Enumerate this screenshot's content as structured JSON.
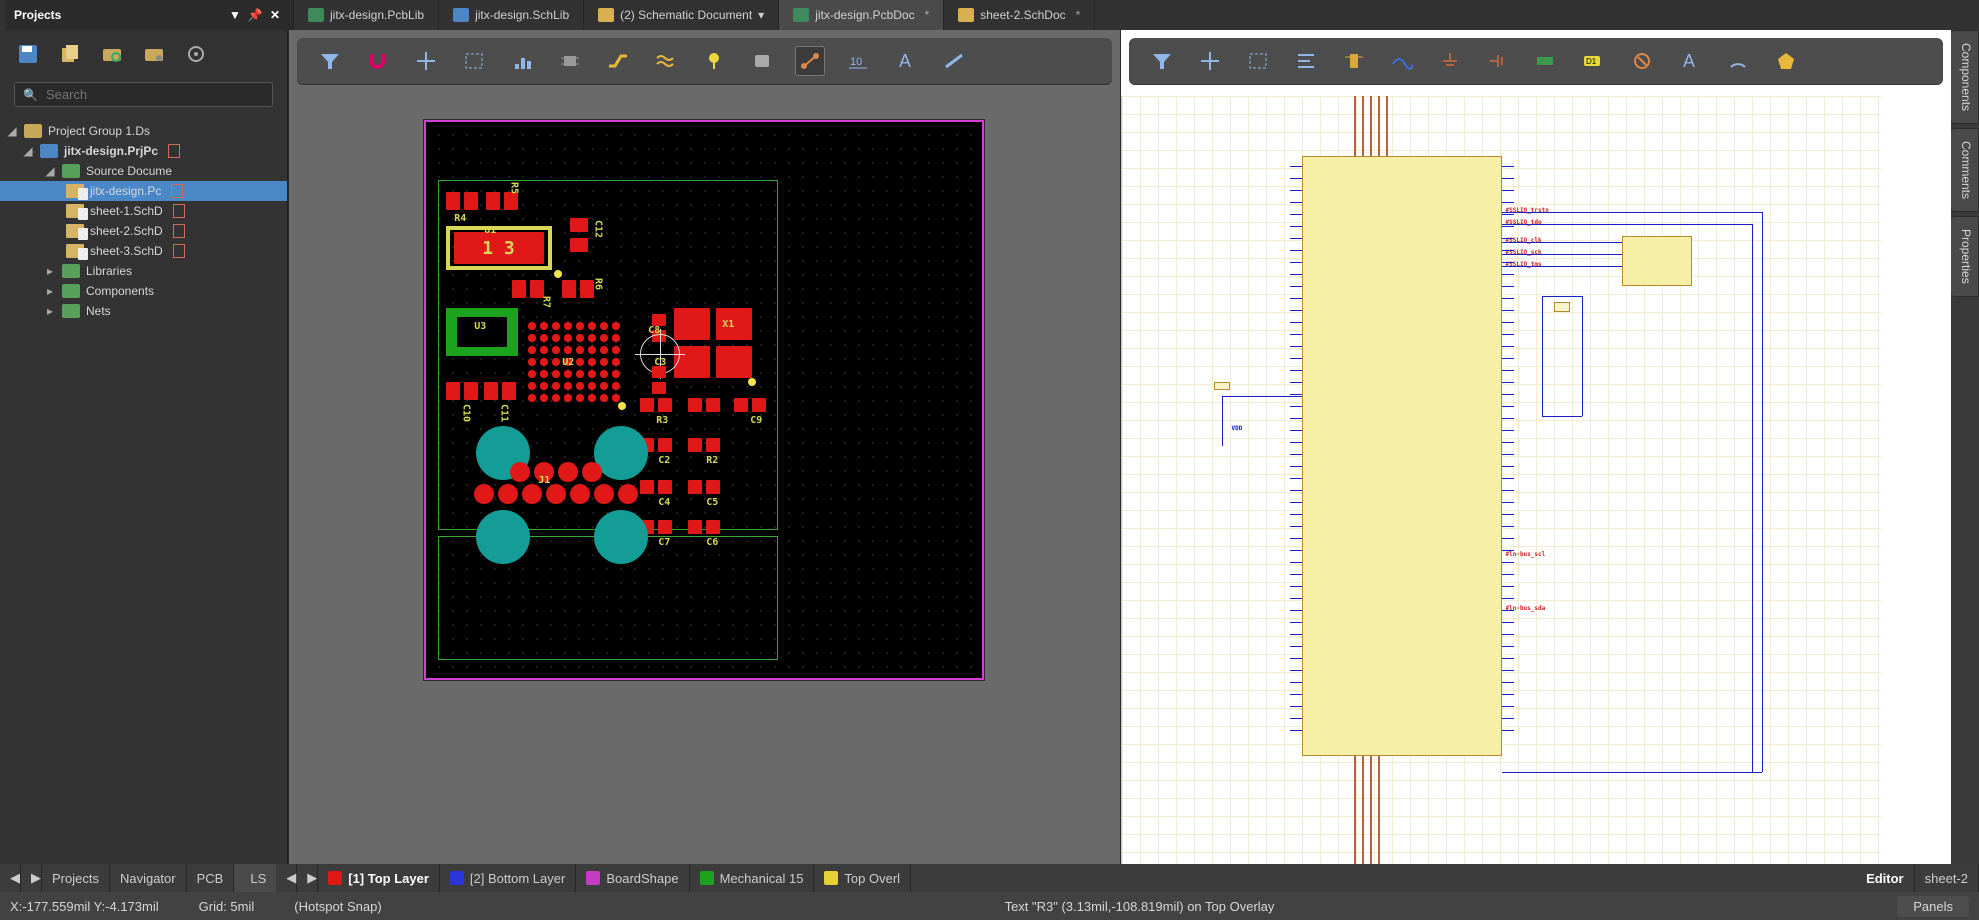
{
  "app": {
    "projects_panel_title": "Projects",
    "panels_btn": "Panels"
  },
  "doc_tabs": [
    {
      "label": "jitx-design.PcbLib",
      "color": "#3e8a5b",
      "dirty": false,
      "active": false
    },
    {
      "label": "jitx-design.SchLib",
      "color": "#4e86c5",
      "dirty": false,
      "active": false
    },
    {
      "label": "(2) Schematic Document",
      "color": "#d8b04f",
      "dirty": false,
      "active": false,
      "dropdown": true
    },
    {
      "label": "jitx-design.PcbDoc",
      "color": "#3e8a5b",
      "dirty": true,
      "active": true
    },
    {
      "label": "sheet-2.SchDoc",
      "color": "#d8b04f",
      "dirty": true,
      "active": false
    }
  ],
  "search": {
    "placeholder": "Search"
  },
  "tree": {
    "rootGroup": "Project Group 1.Ds",
    "project": "jitx-design.PrjPc",
    "sourceFolder": "Source Docume",
    "files": [
      {
        "name": "jitx-design.Pc",
        "selected": true
      },
      {
        "name": "sheet-1.SchD",
        "selected": false
      },
      {
        "name": "sheet-2.SchD",
        "selected": false
      },
      {
        "name": "sheet-3.SchD",
        "selected": false
      }
    ],
    "folders": [
      {
        "name": "Libraries"
      },
      {
        "name": "Components"
      },
      {
        "name": "Nets"
      }
    ]
  },
  "pcb": {
    "designators": [
      "R4",
      "R5",
      "U1",
      "C12",
      "R6",
      "R7",
      "U3",
      "U2",
      "C8",
      "X1",
      "C3",
      "C10",
      "C11",
      "R3",
      "C9",
      "J1",
      "C2",
      "R2",
      "C4",
      "C5",
      "C7",
      "C6"
    ]
  },
  "right_tabs": [
    "Components",
    "Comments",
    "Properties"
  ],
  "tabbar": {
    "left_tabs": [
      "Projects",
      "Navigator",
      "PCB"
    ],
    "ls": "LS",
    "layers": [
      {
        "label": "[1] Top Layer",
        "color": "#e01818",
        "bold": true
      },
      {
        "label": "[2] Bottom Layer",
        "color": "#2a37d8"
      },
      {
        "label": "BoardShape",
        "color": "#c43cc4"
      },
      {
        "label": "Mechanical 15",
        "color": "#1ca21c"
      },
      {
        "label": "Top Overl",
        "color": "#e6d235"
      }
    ],
    "right_editor_tabs": [
      "Editor",
      "sheet-2"
    ]
  },
  "status": {
    "coord": "X:-177.559mil Y:-4.173mil",
    "grid": "Grid: 5mil",
    "snap": "(Hotspot Snap)",
    "hover": "Text \"R3\" (3.13mil,-108.819mil) on Top Overlay"
  }
}
